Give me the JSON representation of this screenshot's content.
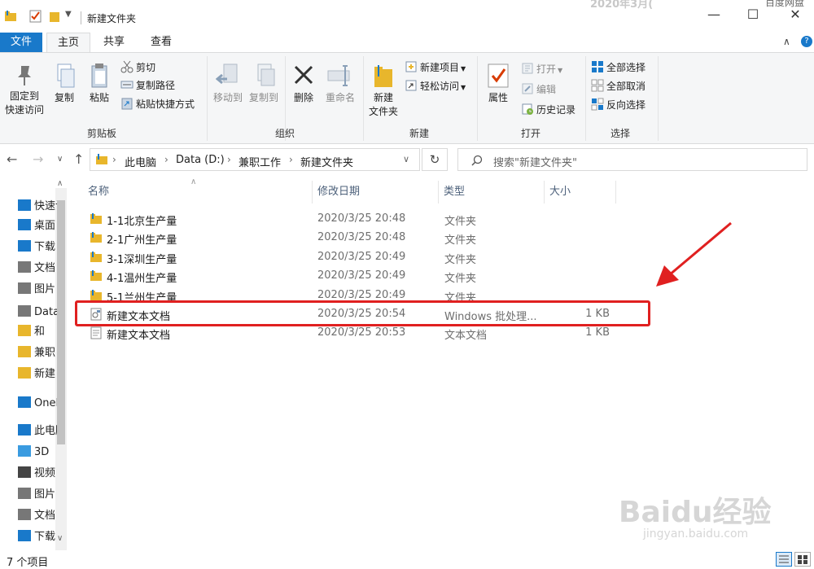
{
  "titlebar": {
    "title": "新建文件夹",
    "date_overlay": "2020年3月(",
    "overlay_right": "百度网盘",
    "min": "—",
    "max": "☐",
    "close": "✕"
  },
  "tabs": {
    "file": "文件",
    "home": "主页",
    "share": "共享",
    "view": "查看",
    "collapse": "∧",
    "help": "?"
  },
  "ribbon": {
    "clipboard": {
      "label": "剪贴板",
      "pin": [
        "固定到",
        "快速访问"
      ],
      "copy": "复制",
      "paste": "粘贴",
      "cut": "剪切",
      "copy_path": "复制路径",
      "paste_shortcut": "粘贴快捷方式"
    },
    "organize": {
      "label": "组织",
      "move_to": "移动到",
      "copy_to": "复制到",
      "delete": "删除",
      "rename": "重命名"
    },
    "new": {
      "label": "新建",
      "new_folder": [
        "新建",
        "文件夹"
      ],
      "new_item": "新建项目",
      "easy_access": "轻松访问"
    },
    "open": {
      "label": "打开",
      "properties": "属性",
      "open": "打开",
      "edit": "编辑",
      "history": "历史记录"
    },
    "select": {
      "label": "选择",
      "select_all": "全部选择",
      "select_none": "全部取消",
      "invert": "反向选择"
    }
  },
  "address": {
    "crumbs": [
      "此电脑",
      "Data (D:)",
      "兼职工作",
      "新建文件夹"
    ],
    "search_placeholder": "搜索\"新建文件夹\""
  },
  "navpane": {
    "items": [
      {
        "label": "快速访问",
        "icon": "star-icon",
        "color": "#1979ca"
      },
      {
        "label": "桌面",
        "icon": "desktop-icon",
        "color": "#1979ca"
      },
      {
        "label": "下载",
        "icon": "download-icon",
        "color": "#1979ca"
      },
      {
        "label": "文档",
        "icon": "document-icon",
        "color": "#777"
      },
      {
        "label": "图片",
        "icon": "picture-icon",
        "color": "#777"
      },
      {
        "label": "Data",
        "icon": "drive-icon",
        "color": "#777"
      },
      {
        "label": "和",
        "icon": "folder-icon",
        "color": "#e8b62c"
      },
      {
        "label": "兼职",
        "icon": "folder-icon",
        "color": "#e8b62c"
      },
      {
        "label": "新建",
        "icon": "folder-icon",
        "color": "#e8b62c"
      },
      {
        "label": "OneDrive",
        "icon": "cloud-icon",
        "color": "#1979ca"
      },
      {
        "label": "此电脑",
        "icon": "pc-icon",
        "color": "#1979ca"
      },
      {
        "label": "3D",
        "icon": "3d-icon",
        "color": "#3a9be0"
      },
      {
        "label": "视频",
        "icon": "video-icon",
        "color": "#444"
      },
      {
        "label": "图片",
        "icon": "picture-icon",
        "color": "#777"
      },
      {
        "label": "文档",
        "icon": "document-icon",
        "color": "#777"
      },
      {
        "label": "下载",
        "icon": "download-icon",
        "color": "#1979ca"
      }
    ]
  },
  "columns": {
    "name": "名称",
    "date": "修改日期",
    "type": "类型",
    "size": "大小"
  },
  "files": [
    {
      "name": "1-1北京生产量",
      "date": "2020/3/25 20:48",
      "type": "文件夹",
      "size": "",
      "icon": "folder-icon"
    },
    {
      "name": "2-1广州生产量",
      "date": "2020/3/25 20:48",
      "type": "文件夹",
      "size": "",
      "icon": "folder-icon"
    },
    {
      "name": "3-1深圳生产量",
      "date": "2020/3/25 20:49",
      "type": "文件夹",
      "size": "",
      "icon": "folder-icon"
    },
    {
      "name": "4-1温州生产量",
      "date": "2020/3/25 20:49",
      "type": "文件夹",
      "size": "",
      "icon": "folder-icon"
    },
    {
      "name": "5-1兰州生产量",
      "date": "2020/3/25 20:49",
      "type": "文件夹",
      "size": "",
      "icon": "folder-icon"
    },
    {
      "name": "新建文本文档",
      "date": "2020/3/25 20:54",
      "type": "Windows 批处理...",
      "size": "1 KB",
      "icon": "batch-file-icon"
    },
    {
      "name": "新建文本文档",
      "date": "2020/3/25 20:53",
      "type": "文本文档",
      "size": "1 KB",
      "icon": "text-file-icon"
    }
  ],
  "status": {
    "count": "7 个项目"
  },
  "watermark": {
    "brand": "Baidu经验",
    "url": "jingyan.baidu.com"
  },
  "colors": {
    "accent": "#1979ca",
    "folder": "#e8b62c",
    "highlight": "#e02020"
  }
}
